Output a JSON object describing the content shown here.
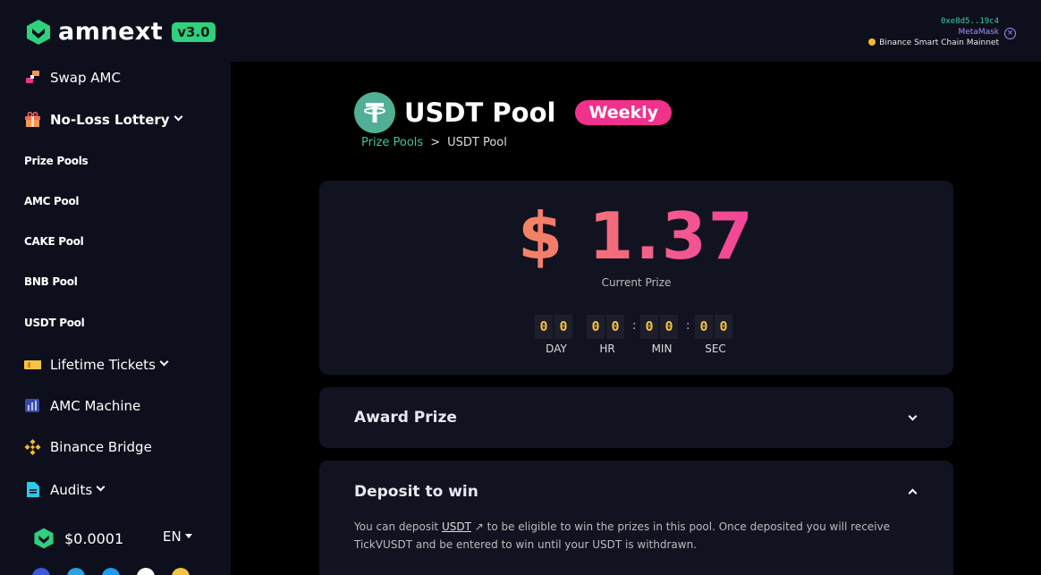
{
  "header": {
    "logo_text": "amnext",
    "version": "v3.0",
    "wallet": {
      "address": "0xe8d5..19c4",
      "provider": "MetaMask",
      "network": "Binance Smart Chain Mainnet"
    }
  },
  "sidebar": {
    "items": [
      {
        "label": "Swap AMC",
        "icon": "swap-icon"
      },
      {
        "label": "No-Loss Lottery",
        "icon": "gift-icon"
      },
      {
        "label": "Prize Pools"
      },
      {
        "label": "AMC Pool"
      },
      {
        "label": "CAKE Pool"
      },
      {
        "label": "BNB Pool"
      },
      {
        "label": "USDT Pool"
      },
      {
        "label": "Lifetime Tickets",
        "icon": "ticket-icon"
      },
      {
        "label": "AMC Machine",
        "icon": "chart-icon"
      },
      {
        "label": "Binance Bridge",
        "icon": "binance-icon"
      },
      {
        "label": "Audits",
        "icon": "document-icon"
      }
    ],
    "price": "$0.0001",
    "language": "EN"
  },
  "pool": {
    "title": "USDT Pool",
    "badge": "Weekly",
    "breadcrumb_link": "Prize Pools",
    "breadcrumb_sep": ">",
    "breadcrumb_current": "USDT Pool"
  },
  "prize": {
    "amount": "$ 1.37",
    "label": "Current Prize"
  },
  "timer": {
    "digits": [
      "0",
      "0",
      "0",
      "0",
      "0",
      "0",
      "0",
      "0"
    ],
    "separator": ":",
    "labels": [
      "DAY",
      "HR",
      "MIN",
      "SEC"
    ]
  },
  "award": {
    "title": "Award Prize"
  },
  "deposit": {
    "title": "Deposit to win",
    "text_before": "You can deposit ",
    "token_link": "USDT",
    "text_after": " to be eligible to win the prizes in this pool. Once deposited you will receive TickVUSDT and be entered to win until your USDT is withdrawn."
  },
  "colors": {
    "accent_green": "#2fd17e",
    "badge_pink": "#f2318b",
    "digit_yellow": "#f5c242",
    "tether_green": "#50af95"
  }
}
